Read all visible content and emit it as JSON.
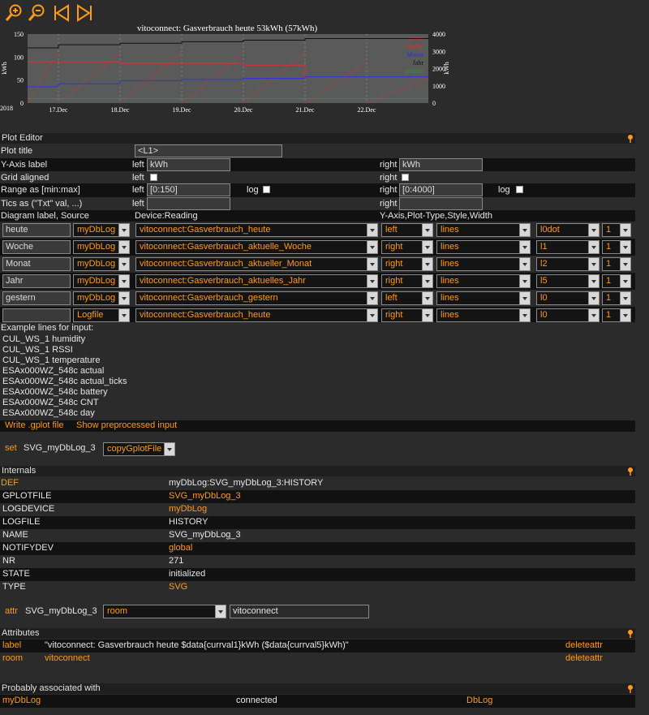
{
  "toolbar": {
    "icons": [
      "zoom-in-icon",
      "zoom-out-icon",
      "prev-icon",
      "next-icon"
    ]
  },
  "chart_data": {
    "type": "line",
    "title": "vitoconnect: Gasverbrauch heute 53kWh (57kWh)",
    "ylabel_left": "kWh",
    "ylabel_right": "kWh",
    "ylim_left": [
      0,
      150
    ],
    "ylim_right": [
      0,
      4000
    ],
    "yticks_left": [
      "0",
      "50",
      "100",
      "150"
    ],
    "yticks_right": [
      "0",
      "1000",
      "2000",
      "3000",
      "4000"
    ],
    "x_start_label": "2018",
    "xticks": [
      "17.Dec",
      "18.Dec",
      "19.Dec",
      "20.Dec",
      "21.Dec",
      "22.Dec"
    ],
    "legend_placement": "top-right",
    "series": [
      {
        "name": "heute",
        "color": "#e03030",
        "axis": "left",
        "style": "dotted-sawtooth",
        "peaks": [
          115,
          110,
          110,
          110,
          110,
          90,
          53
        ]
      },
      {
        "name": "Woche",
        "color": "#e03030",
        "axis": "right",
        "values_x": [
          0,
          0.5,
          1.5,
          2.5,
          3.5,
          4.5,
          6.5
        ],
        "values": [
          2400,
          2400,
          2300,
          2300,
          2200,
          1500,
          1500
        ]
      },
      {
        "name": "Monat",
        "color": "#3030e0",
        "axis": "right",
        "values_x": [
          0,
          0.5,
          1.5,
          2.5,
          3.5,
          4.5,
          6.5
        ],
        "values": [
          950,
          1120,
          1300,
          1370,
          1430,
          1520,
          1580
        ]
      },
      {
        "name": "Jahr",
        "color": "#101010",
        "axis": "right",
        "values_x": [
          0,
          0.5,
          1.5,
          2.5,
          3.5,
          4.5,
          6.5
        ],
        "values": [
          3200,
          3380,
          3470,
          3560,
          3650,
          3740,
          3800
        ]
      },
      {
        "name": "gestern",
        "color": "#20a020",
        "axis": "left",
        "values_x": [
          0,
          0.5,
          1.5,
          2.5,
          3.5,
          4.5,
          6.5
        ],
        "values": [
          10,
          10,
          10,
          10,
          10,
          10,
          10
        ]
      }
    ]
  },
  "plot_editor": {
    "header": "Plot Editor",
    "plot_title_label": "Plot title",
    "plot_title_value": "<L1>",
    "yaxis_label": "Y-Axis label",
    "left": "left",
    "right": "right",
    "yaxis_left_value": "kWh",
    "yaxis_right_value": "kWh",
    "grid_label": "Grid aligned",
    "range_label": "Range as [min:max]",
    "range_left_value": "[0:150]",
    "range_right_value": "[0:4000]",
    "log": "log",
    "tics_label": "Tics as (\"Txt\" val, ...)",
    "col_diag": "Diagram label, Source",
    "col_device": "Device:Reading",
    "col_yaxis": "Y-Axis,Plot-Type,Style,Width",
    "rows": [
      {
        "label": "heute",
        "source": "myDbLog",
        "reading": "vitoconnect:Gasverbrauch_heute",
        "axis": "left",
        "type": "lines",
        "style": "l0dot",
        "width": "1"
      },
      {
        "label": "Woche",
        "source": "myDbLog",
        "reading": "vitoconnect:Gasverbrauch_aktuelle_Woche",
        "axis": "right",
        "type": "lines",
        "style": "l1",
        "width": "1"
      },
      {
        "label": "Monat",
        "source": "myDbLog",
        "reading": "vitoconnect:Gasverbrauch_aktueller_Monat",
        "axis": "right",
        "type": "lines",
        "style": "l2",
        "width": "1"
      },
      {
        "label": "Jahr",
        "source": "myDbLog",
        "reading": "vitoconnect:Gasverbrauch_aktuelles_Jahr",
        "axis": "right",
        "type": "lines",
        "style": "l5",
        "width": "1"
      },
      {
        "label": "gestern",
        "source": "myDbLog",
        "reading": "vitoconnect:Gasverbrauch_gestern",
        "axis": "left",
        "type": "lines",
        "style": "l0",
        "width": "1"
      },
      {
        "label": "",
        "source": "Logfile",
        "reading": "vitoconnect:Gasverbrauch_heute",
        "axis": "right",
        "type": "lines",
        "style": "l0",
        "width": "1"
      }
    ],
    "example_title": "Example lines for input:",
    "examples": [
      "CUL_WS_1 humidity",
      "CUL_WS_1 RSSI",
      "CUL_WS_1 temperature",
      "ESAx000WZ_548c actual",
      "ESAx000WZ_548c actual_ticks",
      "ESAx000WZ_548c battery",
      "ESAx000WZ_548c CNT",
      "ESAx000WZ_548c day"
    ],
    "write_link": "Write .gplot file",
    "show_link": "Show preprocessed input"
  },
  "set_cmd": {
    "label": "set",
    "device": "SVG_myDbLog_3",
    "option": "copyGplotFile"
  },
  "internals": {
    "header": "Internals",
    "rows": [
      {
        "key": "DEF",
        "value": "myDbLog:SVG_myDbLog_3:HISTORY",
        "key_link": true,
        "value_link": false
      },
      {
        "key": "GPLOTFILE",
        "value": "SVG_myDbLog_3",
        "key_link": false,
        "value_link": true
      },
      {
        "key": "LOGDEVICE",
        "value": "myDbLog",
        "key_link": false,
        "value_link": true
      },
      {
        "key": "LOGFILE",
        "value": "HISTORY",
        "key_link": false,
        "value_link": false
      },
      {
        "key": "NAME",
        "value": "SVG_myDbLog_3",
        "key_link": false,
        "value_link": false
      },
      {
        "key": "NOTIFYDEV",
        "value": "global",
        "key_link": false,
        "value_link": true
      },
      {
        "key": "NR",
        "value": "271",
        "key_link": false,
        "value_link": false
      },
      {
        "key": "STATE",
        "value": "initialized",
        "key_link": false,
        "value_link": false
      },
      {
        "key": "TYPE",
        "value": "SVG",
        "key_link": false,
        "value_link": true
      }
    ]
  },
  "attr_cmd": {
    "label": "attr",
    "device": "SVG_myDbLog_3",
    "option": "room",
    "value": "vitoconnect"
  },
  "attributes": {
    "header": "Attributes",
    "rows": [
      {
        "key": "label",
        "value": "\"vitoconnect: Gasverbrauch heute $data{currval1}kWh ($data{currval5}kWh)\"",
        "action": "deleteattr"
      },
      {
        "key": "room",
        "value": "vitoconnect",
        "action": "deleteattr"
      }
    ]
  },
  "associated": {
    "header": "Probably associated with",
    "rows": [
      {
        "name": "myDbLog",
        "status": "connected",
        "type": "DbLog"
      }
    ]
  },
  "colors": {
    "accent": "#ff9a1a",
    "background": "#2b2b2b",
    "row_dark": "#111111",
    "header": "#1f1f1f"
  }
}
